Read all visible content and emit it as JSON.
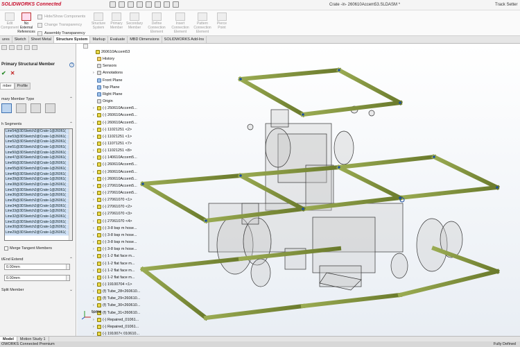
{
  "app": {
    "brand": "SOLIDWORKS Connected",
    "document_title": "Crate -in- 260610Accem53.SLDASM *",
    "user": "Track Setter"
  },
  "ribbon": {
    "edit_component": "Edit\nComponent",
    "no_external_references": "No\nExternal\nReferences",
    "hide_show_components": "Hide/Show Components",
    "change_transparency": "Change Transparency",
    "assembly_transparency": "Assembly Transparency",
    "structure_system": "Structure\nSystem",
    "primary_member": "Primary\nMember",
    "secondary_member": "Secondary\nMember",
    "define_connection_element": "Define\nConnection\nElement",
    "insert_connection_element": "Insert\nConnection\nElement",
    "pattern_connection_element": "Pattern\nConnection\nElement",
    "pierce_point": "Pierce\nPoint"
  },
  "tabs": [
    "ures",
    "Sketch",
    "Sheet Metal",
    "Structure System",
    "Markup",
    "Evaluate",
    "MBD Dimensions",
    "SOLIDWORKS Add-Ins"
  ],
  "active_tab": "Structure System",
  "panel": {
    "title": "Primary Structural Member",
    "subtabs": [
      "mber",
      "Profile"
    ],
    "member_type_header": "mary Member Type",
    "segments_header": "h Segments",
    "segments": [
      "Line54@3DSketch2@Crate-1@26061(",
      "Line53@3DSketch2@Crate-1@26061(",
      "Line52@3DSketch2@Crate-1@26061(",
      "Line51@3DSketch2@Crate-1@26061(",
      "Line50@3DSketch2@Crate-1@26061(",
      "Line47@3DSketch2@Crate-1@26061(",
      "Line56@3DSketch2@Crate-1@26061(",
      "Line55@3DSketch2@Crate-1@26061(",
      "Line40@3DSketch2@Crate-1@26061(",
      "Line39@3DSketch2@Crate-1@26061(",
      "Line38@3DSketch2@Crate-1@26061(",
      "Line37@3DSketch2@Crate-1@26061(",
      "Line36@3DSketch2@Crate-1@26061(",
      "Line35@3DSketch2@Crate-1@26061(",
      "Line34@3DSketch2@Crate-1@26061(",
      "Line33@3DSketch2@Crate-1@26061(",
      "Line32@3DSketch2@Crate-1@26061(",
      "Line31@3DSketch2@Crate-1@26061(",
      "Line30@3DSketch2@Crate-1@26061(",
      "Line29@3DSketch2@Crate-1@26061("
    ],
    "merge_tangent_members": "Merge Tangent Members",
    "end_extend_header": "t/End Extend",
    "extend_start_value": "0.00mm",
    "extend_end_value": "0.00mm",
    "split_member_header": "Split Member"
  },
  "tree": {
    "items": [
      {
        "label": "260610Accem53",
        "icon": "assembly",
        "arrow": "",
        "indent": 0
      },
      {
        "label": "History",
        "icon": "folder",
        "arrow": "",
        "indent": 1
      },
      {
        "label": "Sensors",
        "icon": "plain",
        "arrow": "",
        "indent": 1
      },
      {
        "label": "Annotations",
        "icon": "plain",
        "arrow": "›",
        "indent": 1
      },
      {
        "label": "Front Plane",
        "icon": "plane",
        "arrow": "",
        "indent": 1
      },
      {
        "label": "Top Plane",
        "icon": "plane",
        "arrow": "",
        "indent": 1
      },
      {
        "label": "Right Plane",
        "icon": "plane",
        "arrow": "",
        "indent": 1
      },
      {
        "label": "Origin",
        "icon": "plain",
        "arrow": "",
        "indent": 1
      },
      {
        "label": "(-) 250610Accem5...",
        "icon": "part",
        "arrow": "›",
        "indent": 1
      },
      {
        "label": "(-) 260610Accem5...",
        "icon": "part",
        "arrow": "›",
        "indent": 1
      },
      {
        "label": "(-) 260610Accem5...",
        "icon": "part",
        "arrow": "›",
        "indent": 1
      },
      {
        "label": "(-) 11021251 <2>",
        "icon": "part",
        "arrow": "›",
        "indent": 1
      },
      {
        "label": "(-) 11021251 <1>",
        "icon": "part",
        "arrow": "›",
        "indent": 1
      },
      {
        "label": "(-) 11071251 <7>",
        "icon": "part",
        "arrow": "›",
        "indent": 1
      },
      {
        "label": "(-) 11021251 <8>",
        "icon": "part",
        "arrow": "›",
        "indent": 1
      },
      {
        "label": "(-) 140610Accem5...",
        "icon": "part",
        "arrow": "›",
        "indent": 1
      },
      {
        "label": "(-) 260610Accem5...",
        "icon": "part",
        "arrow": "›",
        "indent": 1
      },
      {
        "label": "(-) 260610Accem5...",
        "icon": "part",
        "arrow": "›",
        "indent": 1
      },
      {
        "label": "(-) 260610Accem5...",
        "icon": "part",
        "arrow": "›",
        "indent": 1
      },
      {
        "label": "(-) 270610Accem5...",
        "icon": "part",
        "arrow": "›",
        "indent": 1
      },
      {
        "label": "(-) 270610Accem5...",
        "icon": "part",
        "arrow": "›",
        "indent": 1
      },
      {
        "label": "(-) 27061070 <1>",
        "icon": "part",
        "arrow": "›",
        "indent": 1
      },
      {
        "label": "(-) 27061070 <2>",
        "icon": "part",
        "arrow": "›",
        "indent": 1
      },
      {
        "label": "(-) 27061070 <3>",
        "icon": "part",
        "arrow": "›",
        "indent": 1
      },
      {
        "label": "(-) 27061070 <4>",
        "icon": "part",
        "arrow": "›",
        "indent": 1
      },
      {
        "label": "(-) 3-8 bsp m hose...",
        "icon": "part",
        "arrow": "›",
        "indent": 1
      },
      {
        "label": "(-) 3-8 bsp m hose...",
        "icon": "part",
        "arrow": "›",
        "indent": 1
      },
      {
        "label": "(-) 3-8 bsp m hose...",
        "icon": "part",
        "arrow": "›",
        "indent": 1
      },
      {
        "label": "(-) 3-8 bsp m hose...",
        "icon": "part",
        "arrow": "›",
        "indent": 1
      },
      {
        "label": "(-) 1-2 flat face m...",
        "icon": "part",
        "arrow": "›",
        "indent": 1
      },
      {
        "label": "(-) 1-2 flat face m...",
        "icon": "part",
        "arrow": "›",
        "indent": 1
      },
      {
        "label": "(-) 1-2 flat face m...",
        "icon": "part",
        "arrow": "›",
        "indent": 1
      },
      {
        "label": "(-) 1-2 flat face m...",
        "icon": "part",
        "arrow": "›",
        "indent": 1
      },
      {
        "label": "(-) 19100704 <1>",
        "icon": "part",
        "arrow": "›",
        "indent": 1
      },
      {
        "label": "(f) Tube_28<260610...",
        "icon": "part",
        "arrow": "›",
        "indent": 1
      },
      {
        "label": "(f) Tube_29<260610...",
        "icon": "part",
        "arrow": "›",
        "indent": 1
      },
      {
        "label": "(f) Tube_30<260610...",
        "icon": "part",
        "arrow": "›",
        "indent": 1
      },
      {
        "label": "(f) Tube_31<260610...",
        "icon": "part",
        "arrow": "›",
        "indent": 1
      },
      {
        "label": "(-) Repaired_01061...",
        "icon": "part",
        "arrow": "›",
        "indent": 1
      },
      {
        "label": "(-) Repaired_01061...",
        "icon": "part",
        "arrow": "›",
        "indent": 1
      },
      {
        "label": "(-) 191007< 010610...",
        "icon": "part",
        "arrow": "›",
        "indent": 1
      }
    ]
  },
  "viewport": {
    "view_label": "tome",
    "frame_color": "#7a8a3a"
  },
  "bottom_tabs": [
    "Model",
    "Motion Study 1"
  ],
  "status": {
    "left": "OWORKS Connected Premium",
    "right": "Fully Defined"
  }
}
